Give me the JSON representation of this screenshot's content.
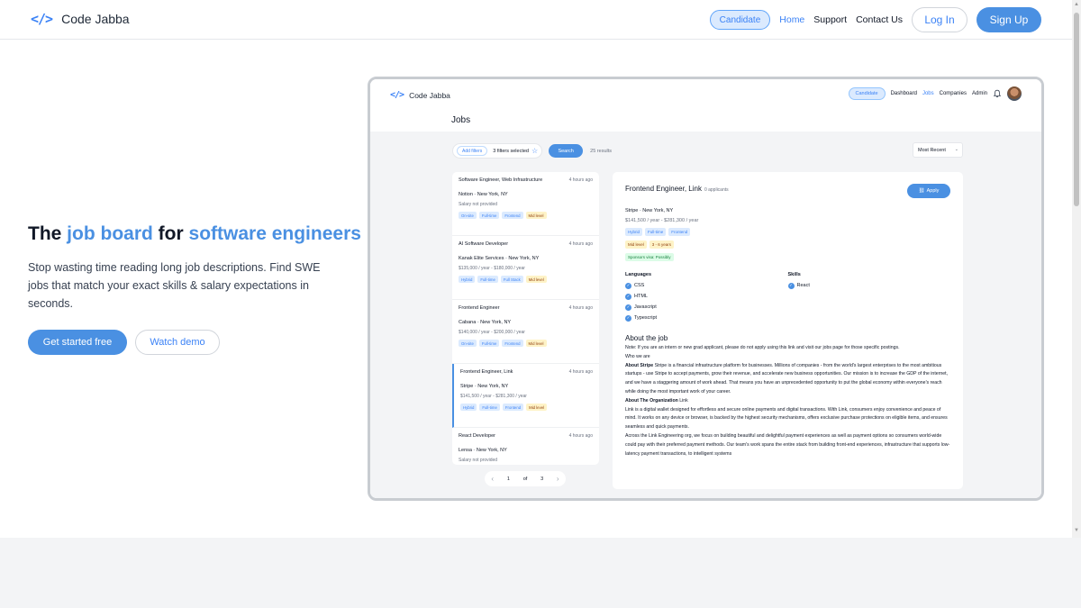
{
  "brand": {
    "logo_glyph": "</>",
    "name": "Code Jabba"
  },
  "nav": {
    "candidate_label": "Candidate",
    "links": [
      "Home",
      "Support",
      "Contact Us"
    ],
    "login_label": "Log In",
    "signup_label": "Sign Up"
  },
  "hero": {
    "title_part1": "The ",
    "title_accent1": "job board",
    "title_part2": " for ",
    "title_accent2": "software engineers",
    "description": "Stop wasting time reading long job descriptions. Find SWE jobs that match your exact skills & salary expectations in seconds.",
    "cta_primary": "Get started free",
    "cta_secondary": "Watch demo"
  },
  "app": {
    "logo_glyph": "</>",
    "name": "Code Jabba",
    "candidate_label": "Candidate",
    "nav_links": [
      "Dashboard",
      "Jobs",
      "Companies",
      "Admin"
    ],
    "page_title": "Jobs",
    "filters": {
      "add_label": "Add filters",
      "selected_label": "3 filters selected",
      "search_label": "Search",
      "results_label": "25 results",
      "sort_label": "Most Recent"
    },
    "jobs": [
      {
        "title": "Software Engineer, Web Infrastructure",
        "time": "4 hours ago",
        "company": "Notion",
        "location": "New York, NY",
        "salary": "Salary not provided",
        "tags": [
          [
            "On-site",
            "blue"
          ],
          [
            "Full-time",
            "blue"
          ],
          [
            "Frontend",
            "blue"
          ],
          [
            "Mid level",
            "yellow"
          ]
        ]
      },
      {
        "title": "AI Software Developer",
        "time": "4 hours ago",
        "company": "Kanak Elite Services",
        "location": "New York, NY",
        "salary": "$135,000 / year - $180,000 / year",
        "tags": [
          [
            "Hybrid",
            "blue"
          ],
          [
            "Full-time",
            "blue"
          ],
          [
            "Full Stack",
            "blue"
          ],
          [
            "Mid level",
            "yellow"
          ]
        ]
      },
      {
        "title": "Frontend Engineer",
        "time": "4 hours ago",
        "company": "Cabana",
        "location": "New York, NY",
        "salary": "$140,000 / year - $200,000 / year",
        "tags": [
          [
            "On-site",
            "blue"
          ],
          [
            "Full-time",
            "blue"
          ],
          [
            "Frontend",
            "blue"
          ],
          [
            "Mid level",
            "yellow"
          ]
        ]
      },
      {
        "title": "Frontend Engineer, Link",
        "time": "4 hours ago",
        "company": "Stripe",
        "location": "New York, NY",
        "salary": "$141,500 / year - $281,300 / year",
        "tags": [
          [
            "Hybrid",
            "blue"
          ],
          [
            "Full-time",
            "blue"
          ],
          [
            "Frontend",
            "blue"
          ],
          [
            "Mid level",
            "yellow"
          ]
        ]
      },
      {
        "title": "React Developer",
        "time": "4 hours ago",
        "company": "Lensa",
        "location": "New York, NY",
        "salary": "Salary not provided",
        "tags": []
      }
    ],
    "pager": {
      "current": "1",
      "of": "of",
      "total": "3"
    },
    "detail": {
      "title": "Frontend Engineer, Link",
      "applicants": "0 applicants",
      "apply_label": "Apply",
      "company": "Stripe",
      "location": "New York, NY",
      "salary": "$141,500 / year - $281,300 / year",
      "tags_row1": [
        [
          "Hybrid",
          "blue"
        ],
        [
          "Full-time",
          "blue"
        ],
        [
          "Frontend",
          "blue"
        ]
      ],
      "tags_row2": [
        [
          "Mid level",
          "yellow"
        ],
        [
          "3 - 6 years",
          "yellow"
        ]
      ],
      "tags_row3": [
        [
          "Sponsors visa: Possibly",
          "green"
        ]
      ],
      "languages_heading": "Languages",
      "languages": [
        "CSS",
        "HTML",
        "Javascript",
        "Typescript"
      ],
      "skills_heading": "Skills",
      "skills": [
        "React"
      ],
      "about_heading": "About the job",
      "about_lines": [
        [
          "",
          "Note: If you are an intern or new grad applicant, please do not apply using this link and visit our jobs page for those specific postings."
        ],
        [
          "",
          "Who we are"
        ],
        [
          "About Stripe",
          " Stripe is a financial infrastructure platform for businesses. Millions of companies - from the world's largest enterprises to the most ambitious startups - use Stripe to accept payments, grow their revenue, and accelerate new business opportunities. Our mission is to increase the GDP of the internet, and we have a staggering amount of work ahead. That means you have an unprecedented opportunity to put the global economy within everyone's reach while doing the most important work of your career."
        ],
        [
          "About The Organization",
          " Link"
        ],
        [
          "",
          "Link is a digital wallet designed for effortless and secure online payments and digital transactions. With Link, consumers enjoy convenience and peace of mind. It works on any device or browser, is backed by the highest security mechanisms, offers exclusive purchase protections on eligible items, and ensures seamless and quick payments."
        ],
        [
          "",
          "Across the Link Engineering org, we focus on building beautiful and delightful payment experiences as well as payment options so consumers world-wide could pay with their preferred payment methods. Our team's work spans the entire stack from building front-end experiences, infrastructure that supports low-latency payment transactions, to intelligent systems"
        ]
      ]
    }
  },
  "colors": {
    "accent": "#4a90e2",
    "accent_light": "#dbeafe",
    "tag_yellow": "#fef3c7",
    "tag_green": "#dcfce7"
  },
  "icons": [
    "code-brackets-icon",
    "star-icon",
    "bell-icon",
    "avatar",
    "check-circle-icon",
    "chevron-left-icon",
    "chevron-right-icon",
    "chevron-down-icon",
    "link-icon"
  ]
}
